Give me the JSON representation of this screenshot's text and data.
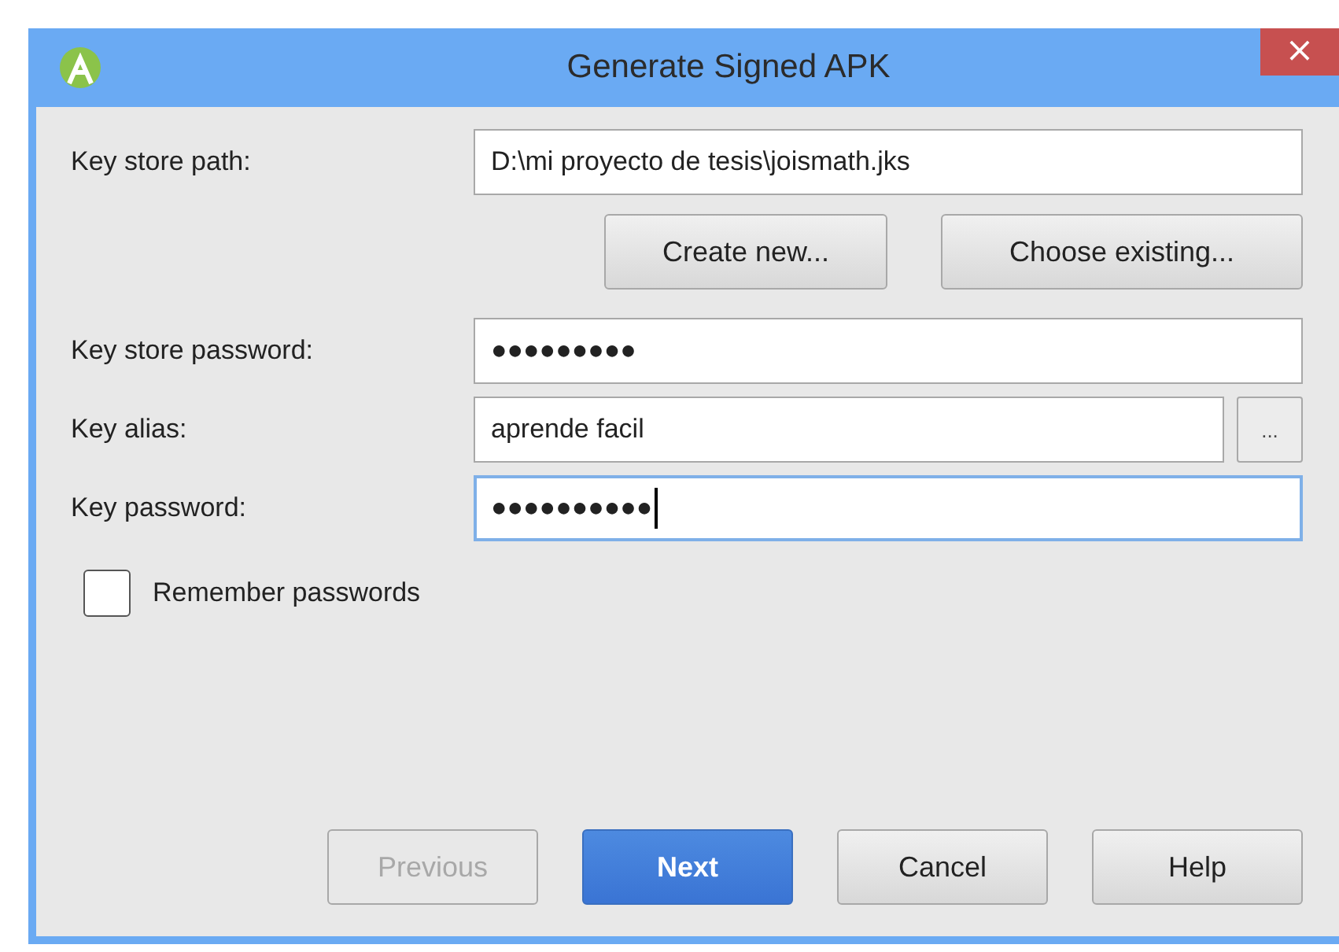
{
  "window": {
    "title": "Generate Signed APK",
    "close": "×"
  },
  "fields": [
    {
      "kind": "text",
      "label": "Key store path:",
      "value": "D:\\mi proyecto de tesis\\joismath.jks",
      "focused": false
    },
    {
      "kind": "buttons",
      "buttons": [
        {
          "label": "Create new..."
        },
        {
          "label": "Choose existing..."
        }
      ]
    },
    {
      "kind": "text",
      "label": "Key store password:",
      "value": "●●●●●●●●●",
      "focused": false
    },
    {
      "kind": "browse",
      "label": "Key alias:",
      "value": "aprende facil",
      "focused": false,
      "button": "..."
    },
    {
      "kind": "text",
      "label": "Key password:",
      "value": "●●●●●●●●●●",
      "focused": true
    }
  ],
  "remember": {
    "label": "Remember passwords",
    "checked": false
  },
  "buttons": [
    {
      "label": "Previous",
      "disabled": true,
      "default": false
    },
    {
      "label": "Next",
      "disabled": false,
      "default": true
    },
    {
      "label": "Cancel",
      "disabled": false,
      "default": false
    },
    {
      "label": "Help",
      "disabled": false,
      "default": false
    }
  ]
}
